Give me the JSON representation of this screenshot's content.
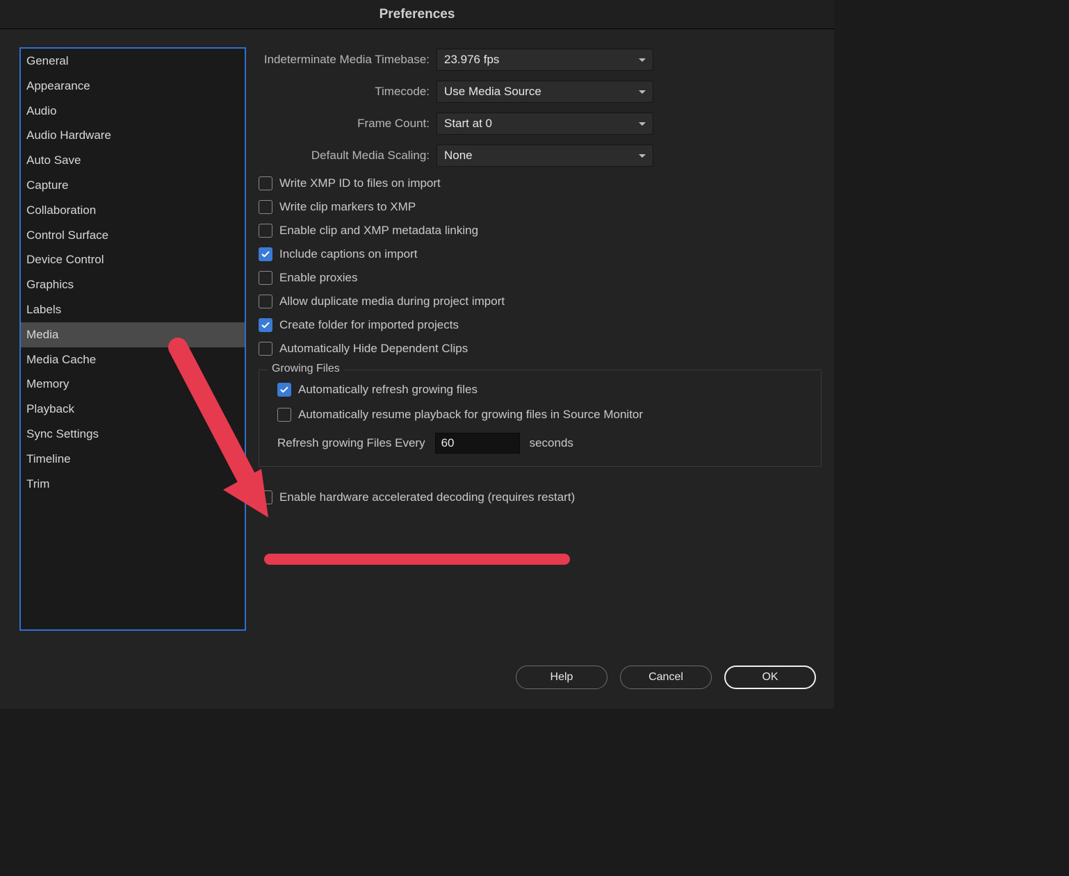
{
  "window": {
    "title": "Preferences"
  },
  "sidebar": {
    "items": [
      {
        "label": "General"
      },
      {
        "label": "Appearance"
      },
      {
        "label": "Audio"
      },
      {
        "label": "Audio Hardware"
      },
      {
        "label": "Auto Save"
      },
      {
        "label": "Capture"
      },
      {
        "label": "Collaboration"
      },
      {
        "label": "Control Surface"
      },
      {
        "label": "Device Control"
      },
      {
        "label": "Graphics"
      },
      {
        "label": "Labels"
      },
      {
        "label": "Media",
        "selected": true
      },
      {
        "label": "Media Cache"
      },
      {
        "label": "Memory"
      },
      {
        "label": "Playback"
      },
      {
        "label": "Sync Settings"
      },
      {
        "label": "Timeline"
      },
      {
        "label": "Trim"
      }
    ]
  },
  "dropdowns": {
    "timebase": {
      "label": "Indeterminate Media Timebase:",
      "value": "23.976 fps"
    },
    "timecode": {
      "label": "Timecode:",
      "value": "Use Media Source"
    },
    "framecount": {
      "label": "Frame Count:",
      "value": "Start at 0"
    },
    "scaling": {
      "label": "Default Media Scaling:",
      "value": "None"
    }
  },
  "checks": {
    "xmp_id": {
      "label": "Write XMP ID to files on import",
      "checked": false
    },
    "clip_markers": {
      "label": "Write clip markers to XMP",
      "checked": false
    },
    "enable_linking": {
      "label": "Enable clip and XMP metadata linking",
      "checked": false
    },
    "captions": {
      "label": "Include captions on import",
      "checked": true
    },
    "proxies": {
      "label": "Enable proxies",
      "checked": false
    },
    "duplicate": {
      "label": "Allow duplicate media during project import",
      "checked": false
    },
    "folder": {
      "label": "Create folder for imported projects",
      "checked": true
    },
    "hide_dep": {
      "label": "Automatically Hide Dependent Clips",
      "checked": false
    },
    "hw_decode": {
      "label": "Enable hardware accelerated decoding (requires restart)",
      "checked": false
    }
  },
  "growing": {
    "title": "Growing Files",
    "auto_refresh": {
      "label": "Automatically refresh growing files",
      "checked": true
    },
    "auto_resume": {
      "label": "Automatically resume playback for growing files in Source Monitor",
      "checked": false
    },
    "refresh_label_pre": "Refresh growing Files Every",
    "refresh_value": "60",
    "refresh_label_post": "seconds"
  },
  "buttons": {
    "help": "Help",
    "cancel": "Cancel",
    "ok": "OK"
  }
}
